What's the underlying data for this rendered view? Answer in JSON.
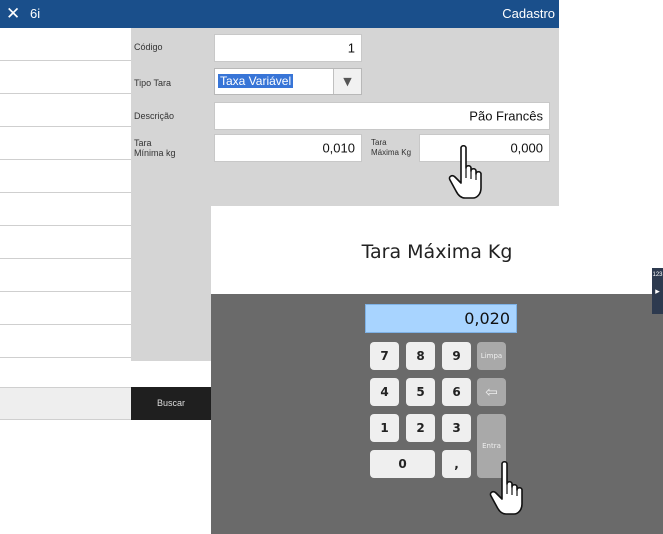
{
  "titlebar": {
    "close_glyph": "✕",
    "app_name": "6i",
    "window_title": "Cadastro"
  },
  "form": {
    "codigo_label": "Código",
    "codigo_value": "1",
    "tipo_label": "Tipo Tara",
    "tipo_value": "Taxa Variável",
    "descricao_label": "Descrição",
    "descricao_value": "Pão Francês",
    "tara_min_label_1": "Tara",
    "tara_min_label_2": "Mínima kg",
    "tara_min_value": "0,010",
    "tara_max_label_1": "Tara",
    "tara_max_label_2": "Máxima Kg",
    "tara_max_value": "0,000"
  },
  "sidebar": {
    "buscar_label": "Buscar"
  },
  "keypad": {
    "title": "Tara Máxima Kg",
    "display_value": "0,020",
    "keys": [
      "7",
      "8",
      "9",
      "4",
      "5",
      "6",
      "1",
      "2",
      "3",
      "0",
      ","
    ],
    "limpa_label": "Limpa",
    "backspace_glyph": "⇦",
    "entra_label": "Entra"
  },
  "side_tab": {
    "label": "123"
  },
  "colors": {
    "titlebar": "#1a4f8b",
    "display": "#a8d4ff",
    "keypad_bg": "#6a6a6a",
    "selection": "#3875d7"
  }
}
